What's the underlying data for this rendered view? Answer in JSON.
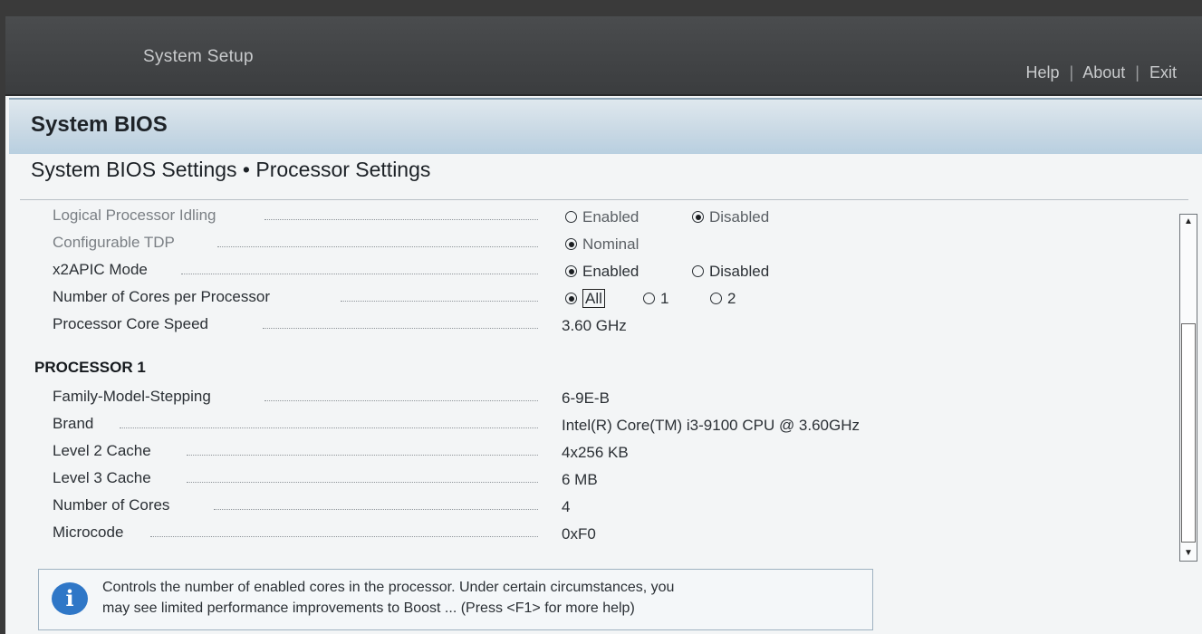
{
  "topbar": {
    "title": "System Setup",
    "links": [
      "Help",
      "About",
      "Exit"
    ],
    "separator": "|"
  },
  "header": {
    "title": "System BIOS"
  },
  "breadcrumb": {
    "text": "System BIOS Settings • Processor Settings"
  },
  "settings": [
    {
      "label": "Logical Processor Idling",
      "dim": true,
      "options": [
        "Enabled",
        "Disabled"
      ],
      "selected": "Disabled"
    },
    {
      "label": "Configurable TDP",
      "dim": true,
      "options": [
        "Nominal"
      ],
      "selected": "Nominal"
    },
    {
      "label": "x2APIC Mode",
      "options": [
        "Enabled",
        "Disabled"
      ],
      "selected": "Enabled"
    },
    {
      "label": "Number of Cores per Processor",
      "options": [
        "All",
        "1",
        "2"
      ],
      "selected": "All"
    },
    {
      "label": "Processor Core Speed",
      "value": "3.60 GHz"
    }
  ],
  "processor_section": {
    "title": "PROCESSOR 1"
  },
  "processor_info": [
    {
      "label": "Family-Model-Stepping",
      "value": "6-9E-B"
    },
    {
      "label": "Brand",
      "value": "Intel(R) Core(TM) i3-9100 CPU @ 3.60GHz"
    },
    {
      "label": "Level 2 Cache",
      "value": "4x256 KB"
    },
    {
      "label": "Level 3 Cache",
      "value": "6 MB"
    },
    {
      "label": "Number of Cores",
      "value": "4"
    },
    {
      "label": "Microcode",
      "value": "0xF0"
    }
  ],
  "help": {
    "icon": "info-icon",
    "line1": "Controls the number of enabled cores in the processor. Under certain circumstances, you",
    "line2": "may see limited performance improvements to Boost ... (Press <F1> for more help)"
  },
  "scrollbar": {
    "up": "▲",
    "down": "▼"
  }
}
